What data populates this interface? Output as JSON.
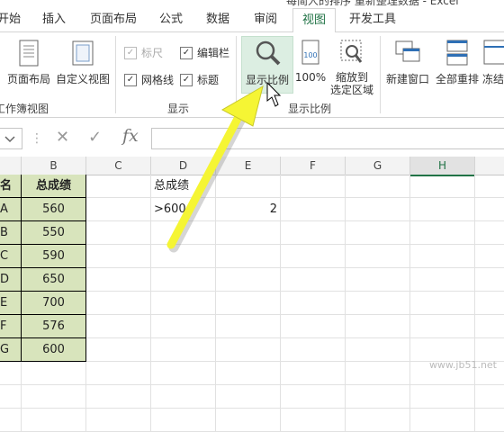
{
  "title_fragment": "每简人的排序 重新整理数据 - Excel",
  "tabs": [
    {
      "label": "开始"
    },
    {
      "label": "插入"
    },
    {
      "label": "页面布局"
    },
    {
      "label": "公式"
    },
    {
      "label": "数据"
    },
    {
      "label": "审阅"
    },
    {
      "label": "视图"
    },
    {
      "label": "开发工具"
    }
  ],
  "ribbon": {
    "page_layout": "页面布局",
    "custom_view": "自定义视图",
    "workbook_views_group": "工作簿视图",
    "ruler": "标尺",
    "formula_bar": "编辑栏",
    "gridlines": "网格线",
    "headings": "标题",
    "show_group": "显示",
    "zoom": "显示比例",
    "zoom_100": "100%",
    "zoom_to_selection_1": "缩放到",
    "zoom_to_selection_2": "选定区域",
    "zoom_group": "显示比例",
    "new_window": "新建窗口",
    "arrange_all": "全部重排",
    "freeze_panes": "冻结"
  },
  "formula": {
    "fx": "fx",
    "cancel": "✕",
    "enter": "✓"
  },
  "columns": [
    "B",
    "C",
    "D",
    "E",
    "F",
    "G",
    "H"
  ],
  "rows": [
    {
      "a": "名",
      "b": "总成绩",
      "d": "总成绩",
      "e": ""
    },
    {
      "a": "A",
      "b": "560",
      "d": ">600",
      "e": "2"
    },
    {
      "a": "B",
      "b": "550",
      "d": "",
      "e": ""
    },
    {
      "a": "C",
      "b": "590",
      "d": "",
      "e": ""
    },
    {
      "a": "D",
      "b": "650",
      "d": "",
      "e": ""
    },
    {
      "a": "E",
      "b": "700",
      "d": "",
      "e": ""
    },
    {
      "a": "F",
      "b": "576",
      "d": "",
      "e": ""
    },
    {
      "a": "G",
      "b": "600",
      "d": "",
      "e": ""
    },
    {
      "a": "",
      "b": "",
      "d": "",
      "e": ""
    },
    {
      "a": "",
      "b": "",
      "d": "",
      "e": ""
    },
    {
      "a": "",
      "b": "",
      "d": "",
      "e": ""
    }
  ],
  "colors": {
    "accent": "#217346",
    "green_fill": "#d8e4bc",
    "arrow": "#f5f534"
  },
  "watermark": "www.jb51.net"
}
